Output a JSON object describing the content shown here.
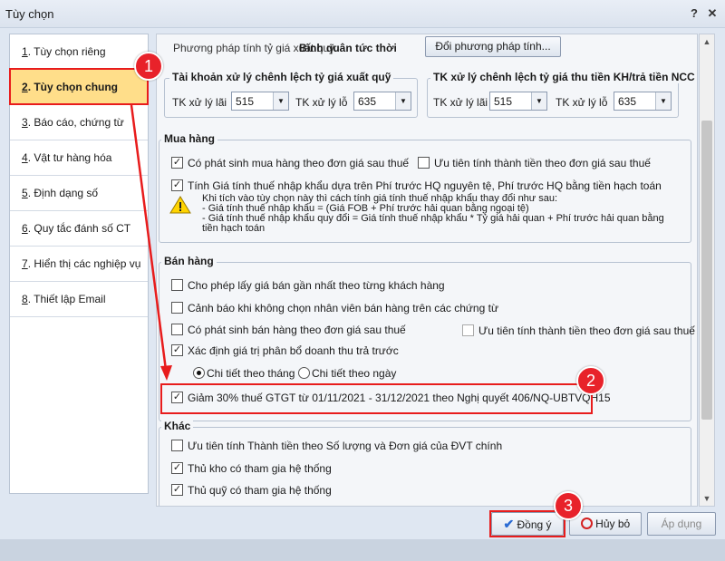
{
  "window": {
    "title": "Tùy chọn",
    "help": "?",
    "close": "✕"
  },
  "nav": {
    "items": [
      {
        "num": "1",
        "label": ". Tùy chọn riêng"
      },
      {
        "num": "2",
        "label": ". Tùy chọn chung"
      },
      {
        "num": "3",
        "label": ". Báo cáo, chứng từ"
      },
      {
        "num": "4",
        "label": ". Vật tư hàng hóa"
      },
      {
        "num": "5",
        "label": ". Định dạng số"
      },
      {
        "num": "6",
        "label": ". Quy tắc đánh số CT"
      },
      {
        "num": "7",
        "label": ". Hiển thị các nghiệp vụ"
      },
      {
        "num": "8",
        "label": ". Thiết lập Email"
      }
    ]
  },
  "exchange": {
    "method_label": "Phương pháp tính tỷ giá xuất quỹ:",
    "method_value": "Bình quân tức thời",
    "change_button": "Đổi phương pháp tính...",
    "group1_title": "Tài khoản xử lý chênh lệch tỷ giá xuất quỹ",
    "group2_title": "TK xử lý chênh lệch tỷ giá thu tiền KH/trả tiền NCC",
    "profit_label": "TK xử lý lãi",
    "loss_label": "TK xử lý lỗ",
    "profit_value": "515",
    "loss_value": "635"
  },
  "purchase": {
    "title": "Mua hàng",
    "opt1": "Có phát sinh mua hàng theo đơn giá sau thuế",
    "opt2": "Ưu tiên tính thành tiền theo đơn giá sau thuế",
    "opt3": "Tính Giá tính thuế nhập khẩu dựa trên Phí trước HQ nguyên tệ, Phí trước HQ bằng tiền hạch toán",
    "note1": "Khi tích vào tùy chọn này thì cách tính giá tính thuế nhập khẩu thay đổi như sau:",
    "note2": "- Giá tính thuế nhập khẩu = (Giá FOB + Phí trước hải quan bằng ngoại tệ)",
    "note3": "- Giá tính thuế nhập khẩu quy đổi = Giá tính thuế nhập khẩu * Tỷ giá hải quan + Phí trước hải quan bằng",
    "note4": "tiền hạch toán"
  },
  "sales": {
    "title": "Bán hàng",
    "opt1": "Cho phép lấy giá bán gần nhất theo từng khách hàng",
    "opt2": "Cảnh báo khi không chọn nhân viên bán hàng trên các chứng từ",
    "opt3": "Có phát sinh bán hàng theo đơn giá sau thuế",
    "opt4": "Ưu tiên tính thành tiền theo đơn giá sau thuế",
    "opt5": "Xác định giá trị phân bổ doanh thu trả trước",
    "radio1": "Chi tiết theo tháng",
    "radio2": "Chi tiết theo ngày",
    "opt6": "Giảm 30% thuế GTGT từ 01/11/2021 - 31/12/2021 theo Nghị quyết 406/NQ-UBTVQH15"
  },
  "other": {
    "title": "Khác",
    "opt1": "Ưu tiên tính Thành tiền theo Số lượng và Đơn giá của ĐVT chính",
    "opt2": "Thủ kho có tham gia hệ thống",
    "opt3": "Thủ quỹ có tham gia hệ thống"
  },
  "buttons": {
    "ok": "Đồng ý",
    "cancel": "Hủy bỏ",
    "apply": "Áp dụng"
  },
  "badges": {
    "b1": "1",
    "b2": "2",
    "b3": "3"
  },
  "colors": {
    "highlight": "#ffde8a",
    "annotation_red": "#e81c1c"
  }
}
